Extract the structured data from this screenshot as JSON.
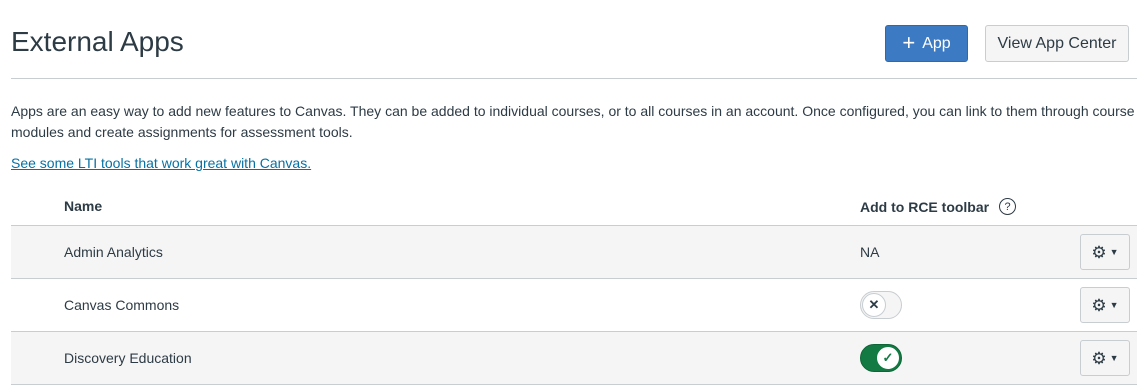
{
  "header": {
    "title": "External Apps",
    "add_app_label": "App",
    "view_app_center_label": "View App Center"
  },
  "intro": {
    "text": "Apps are an easy way to add new features to Canvas. They can be added to individual courses, or to all courses in an account. Once configured, you can link to them through course modules and create assignments for assessment tools.",
    "link_text": "See some LTI tools that work great with Canvas."
  },
  "table": {
    "col_name": "Name",
    "col_rce": "Add to RCE toolbar",
    "help_glyph": "?",
    "rows": [
      {
        "name": "Admin Analytics",
        "rce": "NA"
      },
      {
        "name": "Canvas Commons",
        "rce_toggle": "off"
      },
      {
        "name": "Discovery Education",
        "rce_toggle": "on"
      }
    ]
  },
  "icons": {
    "plus": "+",
    "gear": "⚙",
    "caret": "▼",
    "x": "✕",
    "check": "✓"
  },
  "colors": {
    "primary": "#3c7bc4",
    "link": "#0770a3",
    "success": "#127a42"
  }
}
